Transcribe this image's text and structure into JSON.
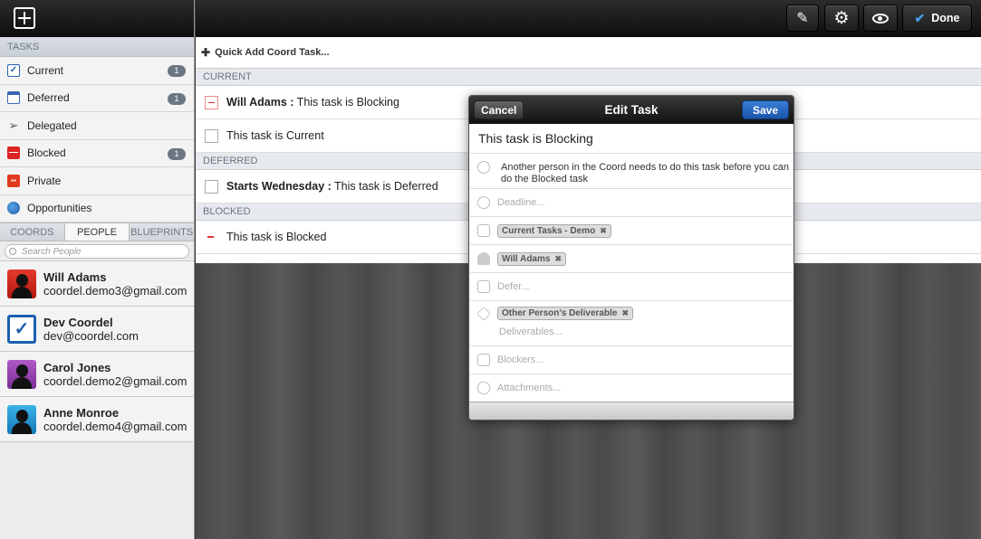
{
  "sidebar": {
    "tasks_header": "TASKS",
    "nav": [
      {
        "label": "Current",
        "badge": "1",
        "icon": "check-icon"
      },
      {
        "label": "Deferred",
        "badge": "1",
        "icon": "calendar-icon"
      },
      {
        "label": "Delegated",
        "badge": "",
        "icon": "paper-plane-icon"
      },
      {
        "label": "Blocked",
        "badge": "1",
        "icon": "blocked-icon"
      },
      {
        "label": "Private",
        "badge": "",
        "icon": "private-icon"
      },
      {
        "label": "Opportunities",
        "badge": "",
        "icon": "globe-icon"
      }
    ],
    "tabs": [
      "COORDS",
      "PEOPLE",
      "BLUEPRINTS"
    ],
    "active_tab": "PEOPLE",
    "search_placeholder": "Search People",
    "people": [
      {
        "name": "Will Adams",
        "email": "coordel.demo3@gmail.com"
      },
      {
        "name": "Dev Coordel",
        "email": "dev@coordel.com"
      },
      {
        "name": "Carol Jones",
        "email": "coordel.demo2@gmail.com"
      },
      {
        "name": "Anne Monroe",
        "email": "coordel.demo4@gmail.com"
      }
    ]
  },
  "toolbar": {
    "done_label": "Done"
  },
  "list": {
    "quick_add": "Quick Add Coord Task...",
    "groups": {
      "current": "CURRENT",
      "deferred": "DEFERRED",
      "blocked": "BLOCKED"
    },
    "tasks": {
      "blocking_prefix": "Will Adams :",
      "blocking_text": " This task is Blocking",
      "current_text": "This task is Current",
      "deferred_prefix": "Starts Wednesday :",
      "deferred_text": " This task is Deferred",
      "blocked_text": "This task is Blocked"
    }
  },
  "dialog": {
    "title": "Edit Task",
    "cancel_label": "Cancel",
    "save_label": "Save",
    "task_name": "This task is Blocking",
    "description": "Another person in the Coord needs to do this task before you can do the Blocked task",
    "deadline_placeholder": "Deadline...",
    "coord_chip": "Current Tasks - Demo",
    "person_chip": "Will Adams",
    "defer_placeholder": "Defer...",
    "deliverable_chip": "Other Person's Deliverable",
    "deliverables_placeholder": "Deliverables...",
    "blockers_placeholder": "Blockers...",
    "attachments_placeholder": "Attachments..."
  }
}
